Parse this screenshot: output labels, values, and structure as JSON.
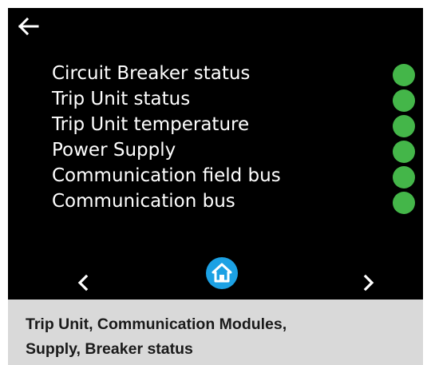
{
  "screen": {
    "background": "#000000",
    "back_icon": "arrow-left-icon",
    "status_items": [
      {
        "label": "Circuit Breaker status",
        "state_color": "#44b649"
      },
      {
        "label": "Trip Unit status",
        "state_color": "#44b649"
      },
      {
        "label": "Trip Unit temperature",
        "state_color": "#44b649"
      },
      {
        "label": "Power Supply",
        "state_color": "#44b649"
      },
      {
        "label": "Communication field bus",
        "state_color": "#44b649"
      },
      {
        "label": "Communication bus",
        "state_color": "#44b649"
      }
    ],
    "nav": {
      "prev_icon": "chevron-left-icon",
      "home_icon": "home-icon",
      "home_color": "#1ca1e4",
      "next_icon": "chevron-right-icon"
    }
  },
  "caption": {
    "line1": "Trip Unit, Communication Modules,",
    "line2": "Supply, Breaker status"
  }
}
